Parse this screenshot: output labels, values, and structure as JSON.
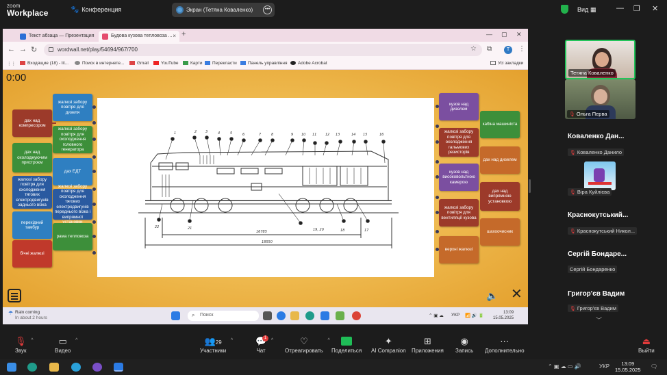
{
  "zoom_top": {
    "logo_line1": "zoom",
    "logo_line2": "Workplace",
    "conference_label": "Конференция",
    "screen_share_label": "Экран (Тетяна Коваленко)",
    "view_label": "Вид"
  },
  "browser": {
    "tab1_title": "Текст абзаца — Презентация",
    "tab2_title": "Будова кузова тепловоза ...",
    "url": "wordwall.net/play/54694/967/700",
    "bookmarks": [
      "Входящие (18) - lit...",
      "Поиск в интернете...",
      "Gmail",
      "YouTube",
      "Карти",
      "Перекласти",
      "Панель управління",
      "Adobe Acrobat",
      "Усі закладки"
    ]
  },
  "game": {
    "timer": "0:00",
    "cards_left": [
      {
        "text": "жалюзі забору повітря для дизеля",
        "color": "#2f7fc1"
      },
      {
        "text": "дах над компресором",
        "color": "#9c3a2a"
      },
      {
        "text": "жалюзі забору повітря для охолодження головного генератора",
        "color": "#3d8f3a"
      },
      {
        "text": "дах над охолоджуючим пристроєм",
        "color": "#3d8f3a"
      },
      {
        "text": "дах ЕДТ",
        "color": "#2f7fc1"
      },
      {
        "text": "жалюзі забору повітря для охолодження тягових електродвигунів заднього візка",
        "color": "#2a5aa0"
      },
      {
        "text": "жалюзі забору повітря для охолодження тягових електродвигунів переднього візка і випрямної установки",
        "color": "#2a5aa0"
      },
      {
        "text": "перехідний тамбур",
        "color": "#2f7fc1"
      },
      {
        "text": "рама тепловоза",
        "color": "#3d8f3a"
      },
      {
        "text": "бічні жалюзі",
        "color": "#c0392b"
      }
    ],
    "cards_right": [
      {
        "text": "кузов над дизелем",
        "color": "#7b4fa0"
      },
      {
        "text": "кабіна машиніста",
        "color": "#3d8f3a"
      },
      {
        "text": "жалюзі забору повітря для охолодження гальмових резисторів",
        "color": "#9c3a2a"
      },
      {
        "text": "дах над дизелем",
        "color": "#c56a2a"
      },
      {
        "text": "кузов над високовольтною камерою",
        "color": "#7b4fa0"
      },
      {
        "text": "дах над випрямною установкою",
        "color": "#9c3a2a"
      },
      {
        "text": "жалюзі забору повітря для вентиляції кузова",
        "color": "#9c3a2a"
      },
      {
        "text": "шахоочисник",
        "color": "#c56a2a"
      },
      {
        "text": "верхні жалюзі",
        "color": "#c56a2a"
      }
    ],
    "drawing_numbers": [
      "1",
      "2",
      "3",
      "4",
      "5",
      "6",
      "7",
      "8",
      "9",
      "10",
      "11",
      "12",
      "13",
      "14",
      "15",
      "16",
      "17",
      "18",
      "19, 20",
      "21",
      "22"
    ],
    "dim_long": "16785",
    "dim_short": "18550"
  },
  "win_taskbar": {
    "weather_title": "Rain coming",
    "weather_sub": "In about 2 hours",
    "search": "Поиск",
    "lang": "УКР",
    "time": "13:09",
    "date": "15.05.2025"
  },
  "participants": {
    "video1_name": "Тетяна Коваленко",
    "video2_name": "Ольга Перва",
    "p1_big": "Коваленко Дан...",
    "p1_small": "Коваленко Данило",
    "p2_small": "Віра Куйлієва",
    "p3_big": "Краснокутський...",
    "p3_small": "Краснокутський Никол...",
    "p4_big": "Сергій Бондаре...",
    "p4_small": "Сергій Бондаренко",
    "p5_big": "Григор'єв Вадим",
    "p5_small": "Григор'єв Вадим"
  },
  "zoom_bottom": {
    "mute": "Звук",
    "video": "Видео",
    "participants": "Участники",
    "participants_count": "29",
    "chat": "Чат",
    "chat_badge": "1",
    "react": "Отреагировать",
    "share": "Поделиться",
    "ai": "AI Companion",
    "apps": "Приложения",
    "record": "Запись",
    "more": "Дополнительно",
    "leave": "Выйти"
  },
  "host_taskbar": {
    "lang": "УКР",
    "time": "13:09",
    "date": "15.05.2025"
  }
}
